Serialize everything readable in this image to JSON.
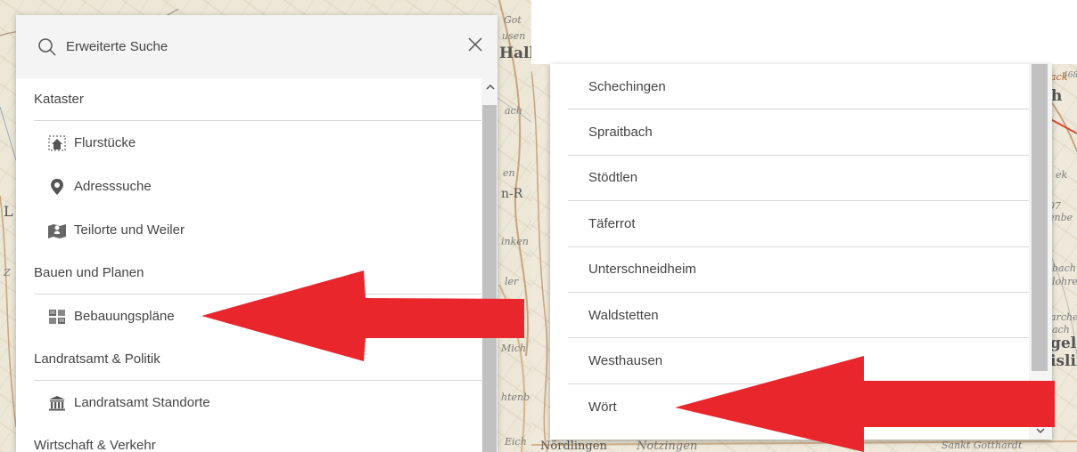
{
  "map": {
    "left_labels": [
      "Got",
      "usen",
      "Hall",
      "ach",
      "n-R",
      "en",
      "inken",
      "ler",
      "Mich",
      "htenb",
      "Eich",
      "L",
      "Z"
    ],
    "right_labels": [
      "ack",
      "468",
      "h",
      "ek",
      "07",
      "enbe",
      "bach",
      "lohre",
      "arche",
      "ach",
      "gel",
      "islir",
      "Notzingen",
      "Sankt Gotthardt",
      "Nördlingen"
    ]
  },
  "search": {
    "label": "Erweiterte Suche",
    "icon": "search-icon",
    "close_icon": "close-icon"
  },
  "left_menu": {
    "sections": [
      {
        "header": "Kataster",
        "items": [
          {
            "label": "Flurstücke",
            "icon": "parcel-house-icon"
          },
          {
            "label": "Adresssuche",
            "icon": "location-pin-icon"
          },
          {
            "label": "Teilorte und Weiler",
            "icon": "map-person-icon"
          }
        ]
      },
      {
        "header": "Bauen und Planen",
        "items": [
          {
            "label": "Bebauungspläne",
            "icon": "zoning-plan-icon"
          }
        ]
      },
      {
        "header": "Landratsamt & Politik",
        "items": [
          {
            "label": "Landratsamt Standorte",
            "icon": "government-building-icon"
          }
        ]
      },
      {
        "header": "Wirtschaft & Verkehr",
        "items": []
      }
    ]
  },
  "right_list": {
    "items": [
      "Schechingen",
      "Spraitbach",
      "Stödtlen",
      "Täferrot",
      "Unterschneidheim",
      "Waldstetten",
      "Westhausen",
      "Wört"
    ]
  },
  "colors": {
    "arrow": "#e8262c",
    "panel_header": "#f4f4f4",
    "scroll_thumb": "#c1c1c1",
    "divider": "#d8d8d8"
  }
}
